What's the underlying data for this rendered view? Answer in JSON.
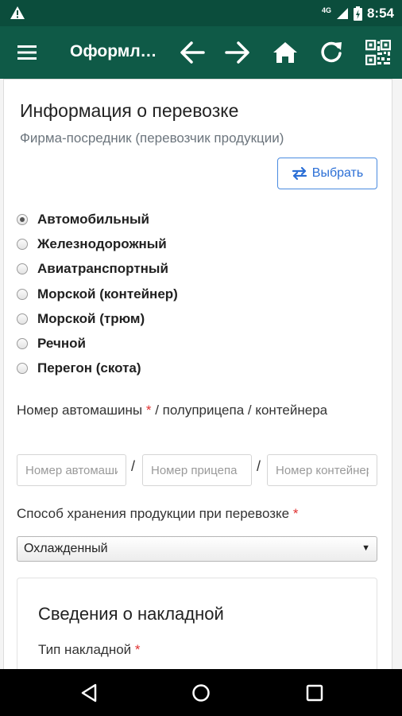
{
  "status_bar": {
    "network": "4G",
    "time": "8:54"
  },
  "toolbar": {
    "title": "Оформление ВСД"
  },
  "section": {
    "title": "Информация о перевозке",
    "intermediary_label": "Фирма-посредник (перевозчик продукции)",
    "choose_button": "Выбрать"
  },
  "transport_types": [
    {
      "label": "Автомобильный",
      "checked": true
    },
    {
      "label": "Железнодорожный",
      "checked": false
    },
    {
      "label": "Авиатранспортный",
      "checked": false
    },
    {
      "label": "Морской (контейнер)",
      "checked": false
    },
    {
      "label": "Морской (трюм)",
      "checked": false
    },
    {
      "label": "Речной",
      "checked": false
    },
    {
      "label": "Перегон (скота)",
      "checked": false
    }
  ],
  "vehicle": {
    "label_part1": "Номер автомашины",
    "required_mark": "*",
    "label_part2": "/ полуприцепа / контейнера",
    "separator": "/",
    "car_placeholder": "Номер автомашины",
    "trailer_placeholder": "Номер прицепа",
    "container_placeholder": "Номер контейнера"
  },
  "storage": {
    "label": "Способ хранения продукции при перевозке",
    "required_mark": "*",
    "selected": "Охлажденный"
  },
  "invoice": {
    "title": "Сведения о накладной",
    "type_label": "Тип накладной",
    "required_mark": "*"
  },
  "colors": {
    "status_bar": "#0b4d3c",
    "toolbar": "#0f5a47",
    "accent_blue": "#2b6fd6",
    "required_red": "#e03131"
  }
}
